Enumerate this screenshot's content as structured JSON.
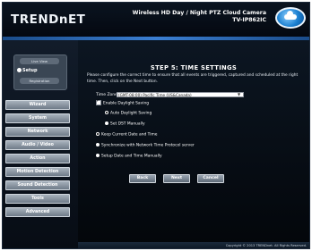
{
  "header": {
    "logo_text": "TRENDnET",
    "product_title": "Wireless HD Day / Night PTZ Cloud Camera",
    "model": "TV-IP862IC",
    "cloud_icon": "cloud-icon"
  },
  "sidebar": {
    "live_view": "Live View",
    "setup": "Setup",
    "registration": "Registration",
    "menu": [
      "Wizard",
      "System",
      "Network",
      "Audio / Video",
      "Action",
      "Motion Detection",
      "Sound Detection",
      "Tools",
      "Advanced"
    ]
  },
  "main": {
    "step_title": "STEP 5: TIME SETTINGS",
    "intro": "Please configure the correct time to ensure that all events are triggered, captured and scheduled at the right time. Then, click on the Next button.",
    "time_zone_label": "Time Zone",
    "time_zone_value": "(GMT-08:00) Pacific Time (US&Canada)",
    "enable_dst": "Enable Daylight Saving",
    "auto_dst": "Auto Daylight Saving",
    "set_dst_manually": "Set DST Manually",
    "keep_current": "Keep Current Date and Time",
    "sync_ntp": "Synchronize with Network Time Protocol server",
    "set_manually": "Setup Date and Time Manually",
    "back_label": "Back",
    "next_label": "Next",
    "cancel_label": "Cancel"
  },
  "footer": {
    "copyright": "Copyright © 2013 TRENDnet. All Rights Reserved."
  }
}
